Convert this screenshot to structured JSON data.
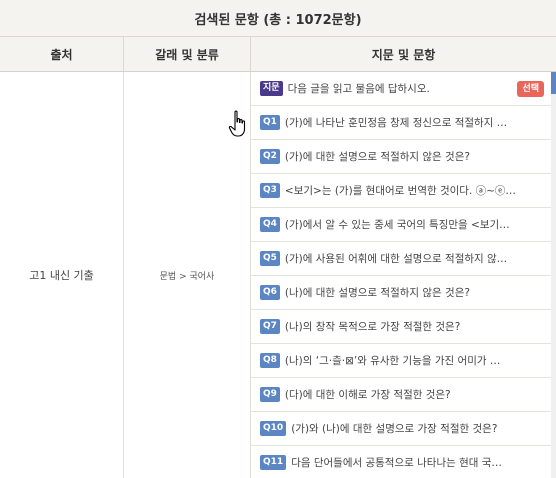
{
  "header": {
    "title": "검색된 문항 (총 : 1072문항)"
  },
  "columns": {
    "source": "출처",
    "category": "갈래 및 분류",
    "question": "지문 및 문항"
  },
  "row": {
    "source": "고1 내신 기출",
    "category": "문법 > 국어사"
  },
  "passage": {
    "badge": "지문",
    "text": "다음 글을 읽고 물음에 답하시오.",
    "select_label": "선택"
  },
  "questions": [
    {
      "badge": "Q1",
      "text": "(가)에 나타난 훈민정음 창제 정신으로 적절하지 …"
    },
    {
      "badge": "Q2",
      "text": "(가)에 대한 설명으로 적절하지 않은 것은?"
    },
    {
      "badge": "Q3",
      "text": "<보기>는 (가)를 현대어로 번역한 것이다. ⓐ~ⓔ…"
    },
    {
      "badge": "Q4",
      "text": "(가)에서 알 수 있는 중세 국어의 특징만을 <보기…"
    },
    {
      "badge": "Q5",
      "text": "(가)에 사용된 어휘에 대한 설명으로 적절하지 않…"
    },
    {
      "badge": "Q6",
      "text": "(나)에 대한 설명으로 적절하지 않은 것은?"
    },
    {
      "badge": "Q7",
      "text": "(나)의 창작 목적으로 가장 적절한 것은?"
    },
    {
      "badge": "Q8",
      "text": "(나)의 ‘그·츨·⊠’와 유사한 기능을 가진 어미가 …"
    },
    {
      "badge": "Q9",
      "text": " (다)에 대한 이해로 가장 적절한 것은?"
    },
    {
      "badge": "Q10",
      "text": "(가)와 (나)에 대한 설명으로 가장 적절한 것은?"
    },
    {
      "badge": "Q11",
      "text": "다음 단어들에서 공통적으로 나타나는 현대 국…"
    }
  ],
  "colors": {
    "badge_blue": "#5b86c3",
    "badge_passage": "#4a3a8c",
    "select_red": "#e8665a"
  },
  "icons": {
    "cursor": "hand-pointer-icon"
  }
}
